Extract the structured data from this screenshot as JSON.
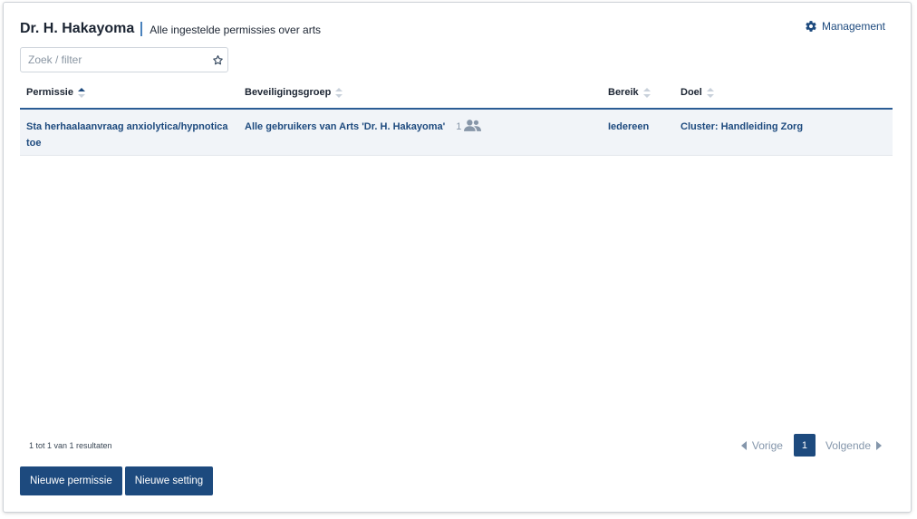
{
  "header": {
    "title": "Dr. H. Hakayoma",
    "subtitle": "Alle ingestelde permissies over arts",
    "management_label": "Management"
  },
  "search": {
    "placeholder": "Zoek / filter",
    "value": ""
  },
  "table": {
    "columns": [
      "Permissie",
      "Beveiligingsgroep",
      "Bereik",
      "Doel"
    ],
    "sorted_column": "Permissie",
    "sort_direction": "ascending",
    "rows": [
      {
        "permissie": "Sta herhaalaanvraag anxiolytica/hypnotica toe",
        "beveiligingsgroep": "Alle gebruikers van Arts 'Dr. H. Hakayoma'",
        "member_count": "1",
        "bereik": "Iedereen",
        "doel": "Cluster: Handleiding Zorg"
      }
    ]
  },
  "footer": {
    "result_info": "1 tot 1 van 1 resultaten"
  },
  "pagination": {
    "prev_label": "Vorige",
    "current_page": "1",
    "next_label": "Volgende"
  },
  "actions": {
    "new_permission_label": "Nieuwe permissie",
    "new_setting_label": "Nieuwe setting"
  },
  "colors": {
    "primary": "#1d4a7e",
    "accent_line": "#2b5d95",
    "muted": "#8496ab",
    "row_bg": "#f1f4f8"
  },
  "icons": {
    "management": "gear-icon",
    "search_favorite": "star-icon",
    "group_members": "users-icon",
    "sort": "sort-icon",
    "prev": "caret-left-icon",
    "next": "caret-right-icon"
  }
}
